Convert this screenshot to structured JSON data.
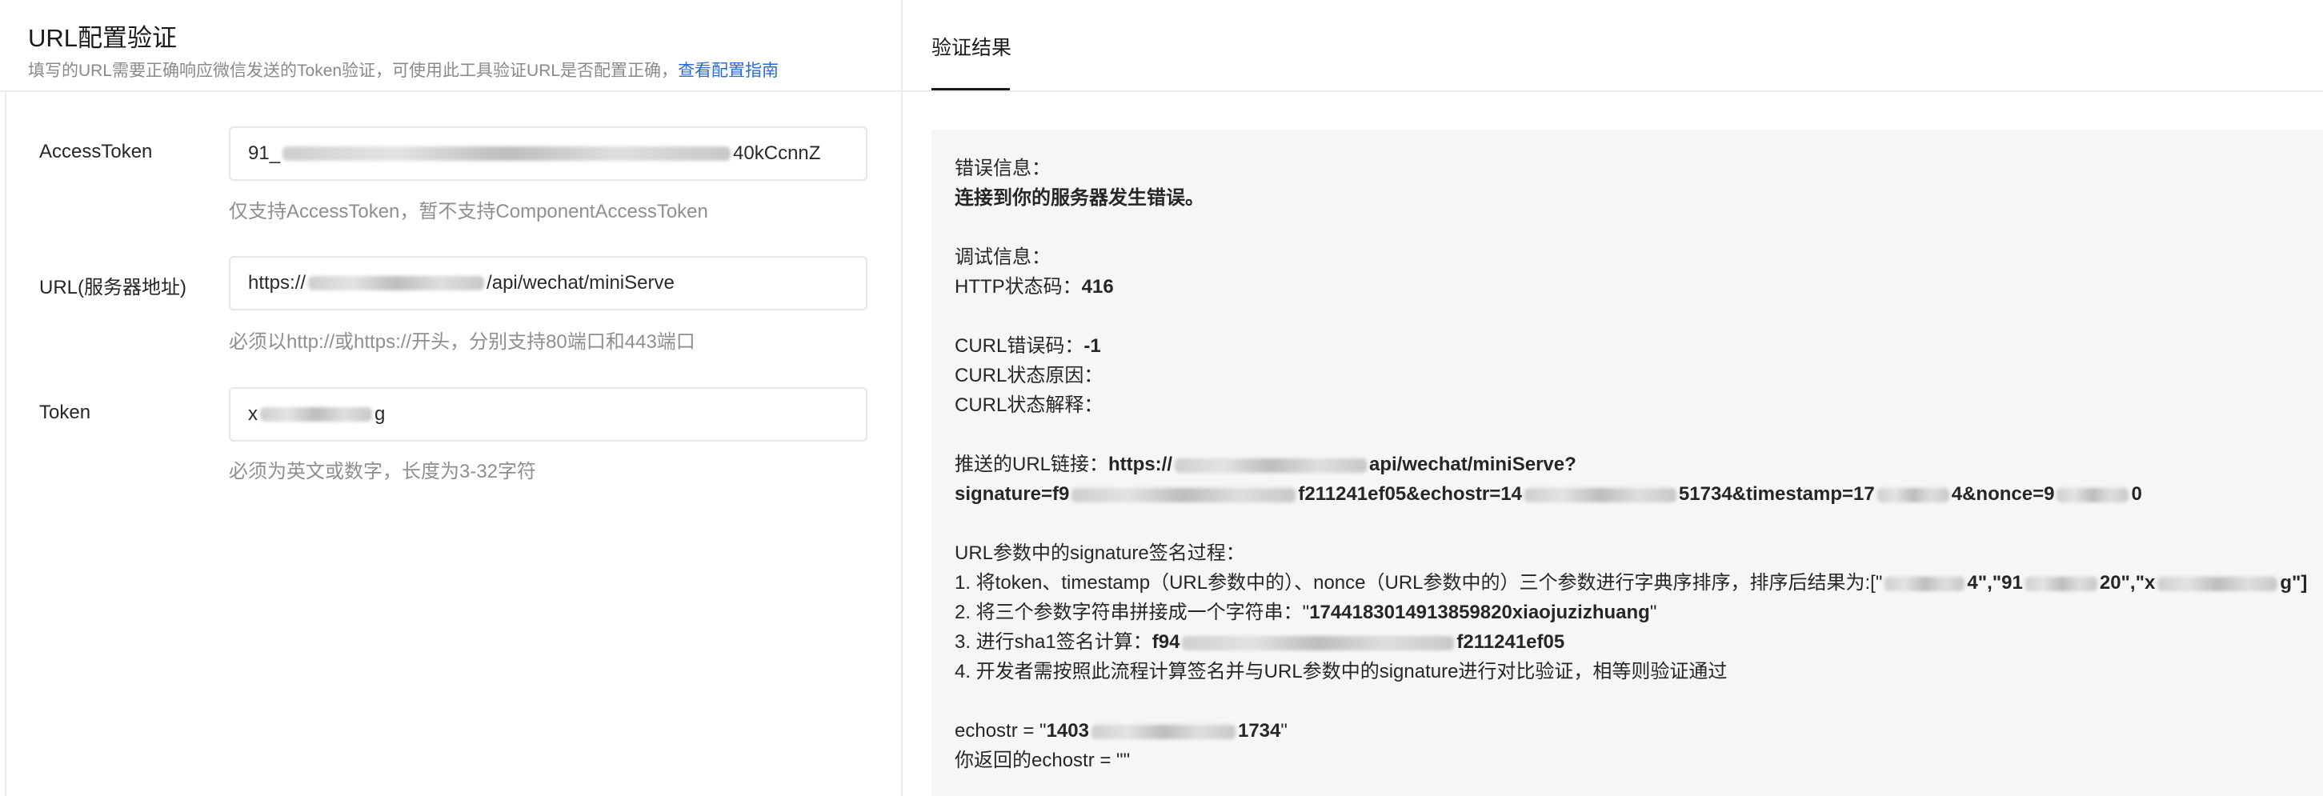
{
  "left_panel": {
    "title": "URL配置验证",
    "subtitle_text": "填写的URL需要正确响应微信发送的Token验证，可使用此工具验证URL是否配置正确，",
    "subtitle_link": "查看配置指南",
    "fields": {
      "access_token": {
        "label": "AccessToken",
        "value_start": "91_",
        "value_end": "40kCcnnZ",
        "hint": "仅支持AccessToken，暂不支持ComponentAccessToken"
      },
      "url": {
        "label": "URL(服务器地址)",
        "value_start": "https://",
        "value_end": "/api/wechat/miniServe",
        "hint": "必须以http://或https://开头，分别支持80端口和443端口"
      },
      "token": {
        "label": "Token",
        "value_start": "x",
        "value_end": "g",
        "hint": "必须为英文或数字，长度为3-32字符"
      }
    }
  },
  "right_panel": {
    "tab_label": "验证结果",
    "error_label": "错误信息：",
    "error_text": "连接到你的服务器发生错误。",
    "debug_label": "调试信息：",
    "http_status_label": "HTTP状态码：",
    "http_status_value": "416",
    "curl_error_label": "CURL错误码：",
    "curl_error_value": "-1",
    "curl_reason_label": "CURL状态原因：",
    "curl_explain_label": "CURL状态解释：",
    "push_url_label": "推送的URL链接：",
    "push_url_line1_start": "https://",
    "push_url_line1_end": "api/wechat/miniServe?",
    "push_url_line2_a": "signature=f9",
    "push_url_line2_b": "f211241ef05&echostr=14",
    "push_url_line2_c": "51734&timestamp=17",
    "push_url_line2_d": "4&nonce=9",
    "push_url_line2_e": "0",
    "sig_process_label": "URL参数中的signature签名过程：",
    "step1_text": "1. 将token、timestamp（URL参数中的）、nonce（URL参数中的）三个参数进行字典序排序，排序后结果为:[\"",
    "step1_v1_end": "4\",\"",
    "step1_v2_start": "91",
    "step1_v2_end": "20\",\"",
    "step1_v3_start": "x",
    "step1_v3_end": "g\"]",
    "step2_text": "2. 将三个参数字符串拼接成一个字符串：\"",
    "step2_value": "1744183014913859820xiaojuzizhuang",
    "step2_close": "\"",
    "step3_text": "3. 进行sha1签名计算：",
    "step3_value_start": "f94",
    "step3_value_end": "f211241ef05",
    "step4_text": "4. 开发者需按照此流程计算签名并与URL参数中的signature进行对比验证，相等则验证通过",
    "echostr_label": "echostr = \"",
    "echostr_start": "1403",
    "echostr_end": "1734",
    "echostr_close": "\"",
    "returned_echostr": "你返回的echostr = \"\""
  }
}
